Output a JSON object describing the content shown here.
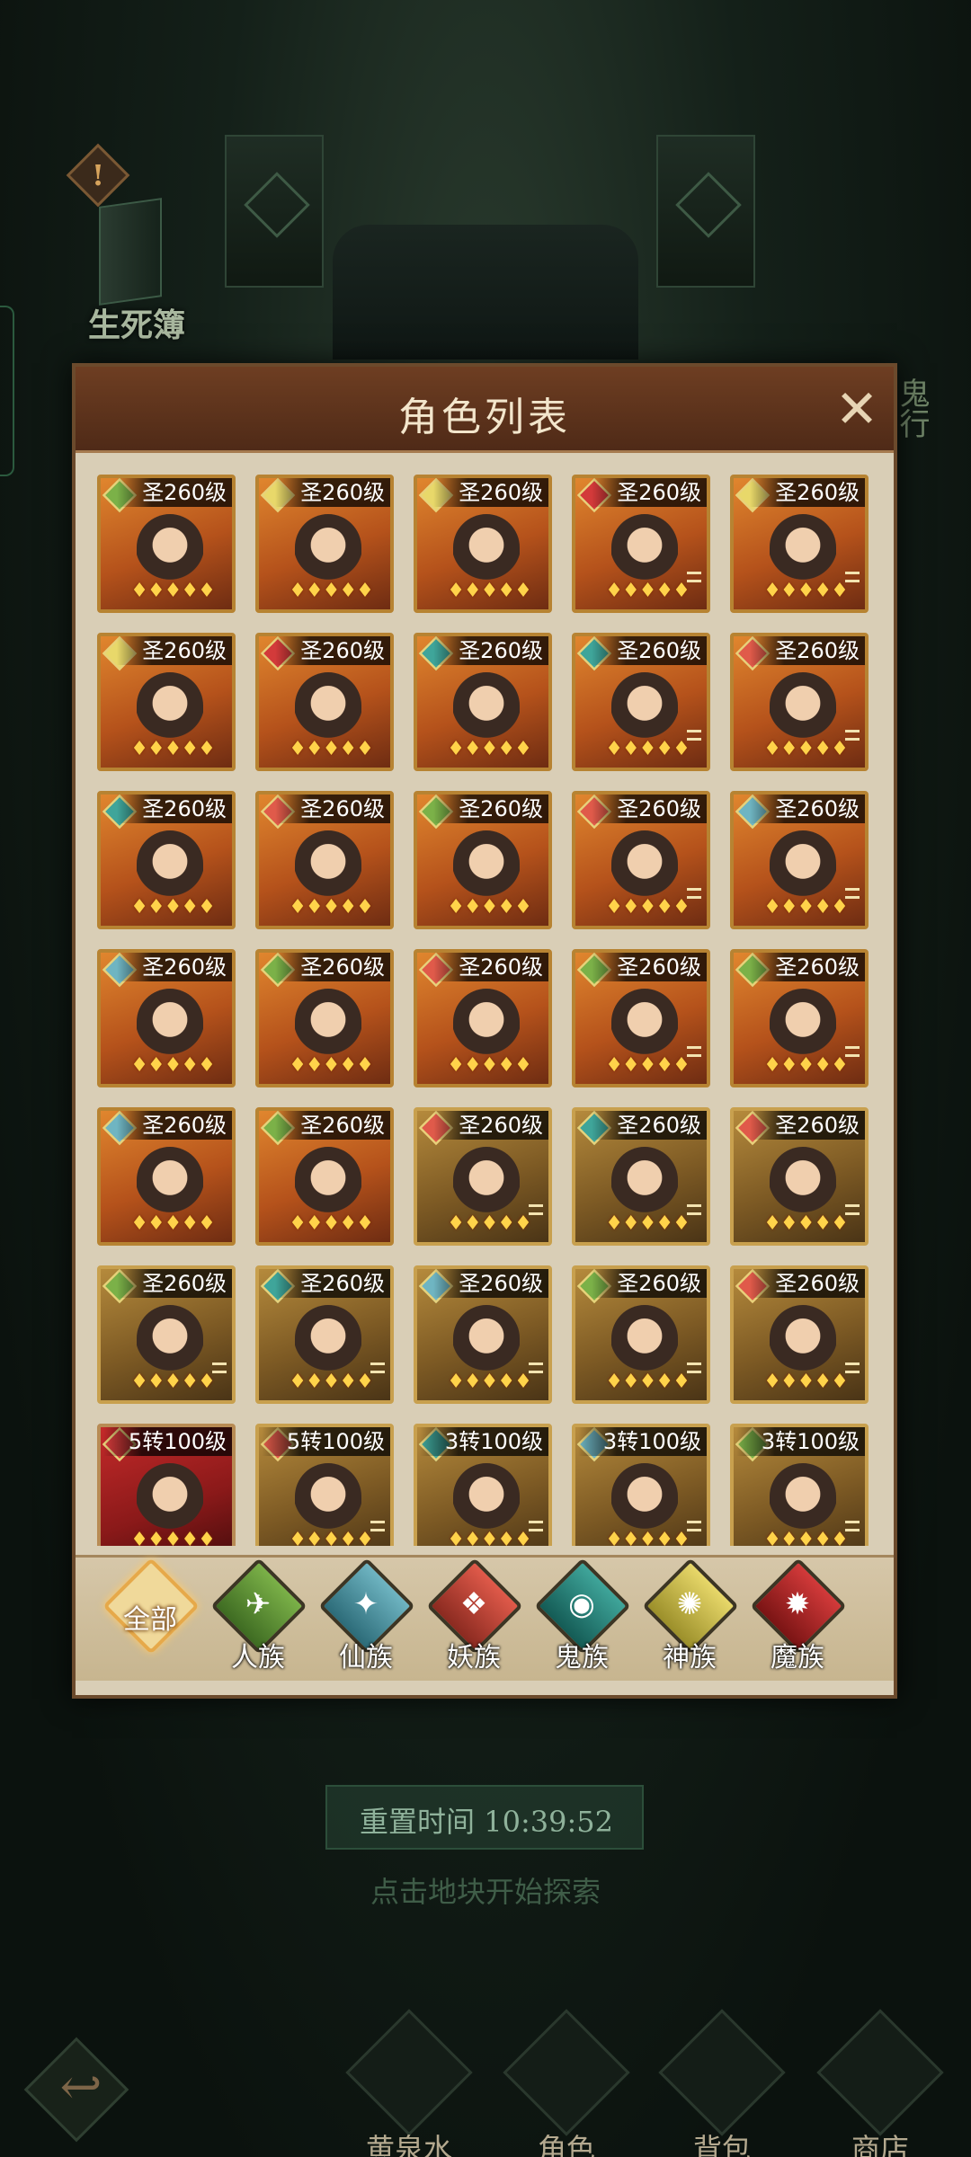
{
  "background": {
    "side_label": "生死簿",
    "right_label": "鬼行"
  },
  "dialog": {
    "title": "角色列表",
    "close_icon": "close-x-icon"
  },
  "characters": [
    {
      "level": "圣260级",
      "style": "orange",
      "race": "human"
    },
    {
      "level": "圣260级",
      "style": "orange",
      "race": "god"
    },
    {
      "level": "圣260级",
      "style": "orange",
      "race": "god"
    },
    {
      "level": "圣260级",
      "style": "orange",
      "race": "devil"
    },
    {
      "level": "圣260级",
      "style": "orange",
      "race": "god"
    },
    {
      "level": "圣260级",
      "style": "orange",
      "race": "god"
    },
    {
      "level": "圣260级",
      "style": "orange",
      "race": "devil"
    },
    {
      "level": "圣260级",
      "style": "orange",
      "race": "ghost"
    },
    {
      "level": "圣260级",
      "style": "orange",
      "race": "ghost"
    },
    {
      "level": "圣260级",
      "style": "orange",
      "race": "demon"
    },
    {
      "level": "圣260级",
      "style": "orange",
      "race": "ghost"
    },
    {
      "level": "圣260级",
      "style": "orange",
      "race": "demon"
    },
    {
      "level": "圣260级",
      "style": "orange",
      "race": "human"
    },
    {
      "level": "圣260级",
      "style": "orange",
      "race": "demon"
    },
    {
      "level": "圣260级",
      "style": "orange",
      "race": "immortal"
    },
    {
      "level": "圣260级",
      "style": "orange",
      "race": "immortal"
    },
    {
      "level": "圣260级",
      "style": "orange",
      "race": "human"
    },
    {
      "level": "圣260级",
      "style": "orange",
      "race": "demon"
    },
    {
      "level": "圣260级",
      "style": "orange",
      "race": "human"
    },
    {
      "level": "圣260级",
      "style": "orange",
      "race": "human"
    },
    {
      "level": "圣260级",
      "style": "orange",
      "race": "immortal"
    },
    {
      "level": "圣260级",
      "style": "orange",
      "race": "human"
    },
    {
      "level": "圣260级",
      "style": "gold",
      "race": "demon"
    },
    {
      "level": "圣260级",
      "style": "gold",
      "race": "ghost"
    },
    {
      "level": "圣260级",
      "style": "gold",
      "race": "demon"
    },
    {
      "level": "圣260级",
      "style": "gold",
      "race": "human"
    },
    {
      "level": "圣260级",
      "style": "gold",
      "race": "ghost"
    },
    {
      "level": "圣260级",
      "style": "gold",
      "race": "immortal"
    },
    {
      "level": "圣260级",
      "style": "gold",
      "race": "human"
    },
    {
      "level": "圣260级",
      "style": "gold",
      "race": "demon"
    },
    {
      "level": "5转100级",
      "style": "red",
      "race": "devil"
    },
    {
      "level": "5转100级",
      "style": "gold",
      "race": "demon"
    },
    {
      "level": "3转100级",
      "style": "gold",
      "race": "ghost"
    },
    {
      "level": "3转100级",
      "style": "gold",
      "race": "immortal"
    },
    {
      "level": "3转100级",
      "style": "gold",
      "race": "human"
    }
  ],
  "filters": [
    {
      "label": "全部",
      "key": "all",
      "icon": "all-filter-icon"
    },
    {
      "label": "人族",
      "key": "human",
      "icon": "swallow-icon"
    },
    {
      "label": "仙族",
      "key": "immortal",
      "icon": "crane-icon"
    },
    {
      "label": "妖族",
      "key": "demon",
      "icon": "fox-mask-icon"
    },
    {
      "label": "鬼族",
      "key": "ghost",
      "icon": "ghost-mask-icon"
    },
    {
      "label": "神族",
      "key": "god",
      "icon": "phoenix-icon"
    },
    {
      "label": "魔族",
      "key": "devil",
      "icon": "demon-mask-icon"
    }
  ],
  "reset": {
    "label": "重置时间 10:39:52"
  },
  "hint": "点击地块开始探索",
  "bottom_nav": [
    {
      "label": "黄泉水",
      "icon": "water-bowl-icon"
    },
    {
      "label": "角色",
      "icon": "character-icon"
    },
    {
      "label": "背包",
      "icon": "bag-icon"
    },
    {
      "label": "商店",
      "icon": "shop-icon"
    }
  ],
  "colors": {
    "human": "#7bb148",
    "immortal": "#6fb5c2",
    "demon": "#e05a4a",
    "ghost": "#3fa59a",
    "god": "#e8d86a",
    "devil": "#d33a3a"
  }
}
